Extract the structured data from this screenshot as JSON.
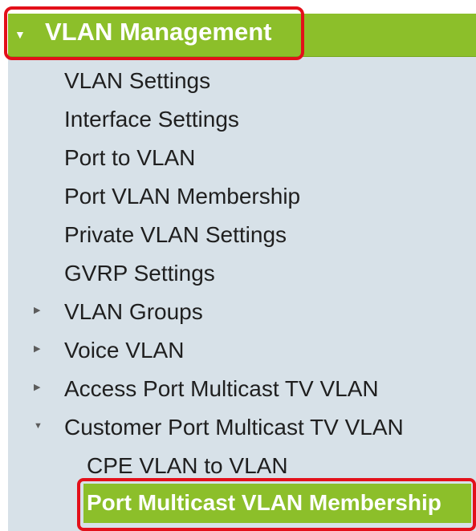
{
  "header": {
    "title": "VLAN Management",
    "expanded": true,
    "arrow_icon": "▼"
  },
  "menu": {
    "items": [
      {
        "label": "VLAN Settings"
      },
      {
        "label": "Interface Settings"
      },
      {
        "label": "Port to VLAN"
      },
      {
        "label": "Port VLAN Membership"
      },
      {
        "label": "Private VLAN Settings"
      },
      {
        "label": "GVRP Settings"
      },
      {
        "label": "VLAN Groups",
        "expander": "▶"
      },
      {
        "label": "Voice VLAN",
        "expander": "▶"
      },
      {
        "label": "Access Port Multicast TV VLAN",
        "expander": "▶"
      },
      {
        "label": "Customer Port Multicast TV VLAN",
        "expander": "▼"
      }
    ],
    "sub_items": [
      {
        "label": "CPE VLAN to VLAN"
      },
      {
        "label": "Port Multicast VLAN Membership",
        "selected": true
      }
    ]
  },
  "colors": {
    "accent_green": "#8cbf2a",
    "panel_background": "#d7e1e8",
    "highlight_red": "#e3101a",
    "text": "#1f1f1f"
  }
}
